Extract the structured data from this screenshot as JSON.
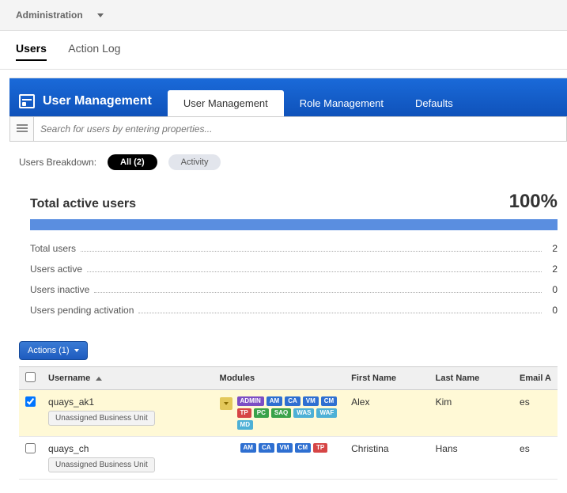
{
  "topbar": {
    "admin_label": "Administration"
  },
  "subtabs": {
    "users": "Users",
    "action_log": "Action Log"
  },
  "hero": {
    "title": "User Management",
    "tabs": {
      "user_mgmt": "User Management",
      "role_mgmt": "Role Management",
      "defaults": "Defaults"
    }
  },
  "search": {
    "placeholder": "Search for users by entering properties..."
  },
  "breakdown": {
    "label": "Users Breakdown:",
    "all_label": "All",
    "all_count": "(2)",
    "activity_label": "Activity"
  },
  "stats": {
    "title": "Total active users",
    "pct": "100%",
    "rows": [
      {
        "label": "Total users",
        "value": "2"
      },
      {
        "label": "Users active",
        "value": "2"
      },
      {
        "label": "Users inactive",
        "value": "0"
      },
      {
        "label": "Users pending activation",
        "value": "0"
      }
    ]
  },
  "actions_button": "Actions (1)",
  "table": {
    "headers": {
      "username": "Username",
      "modules": "Modules",
      "first": "First Name",
      "last": "Last Name",
      "email": "Email A"
    },
    "rows": [
      {
        "checked": true,
        "username": "quays_ak1",
        "bu": "Unassigned Business Unit",
        "modules": [
          "ADMIN",
          "AM",
          "CA",
          "VM",
          "CM",
          "TP",
          "PC",
          "SAQ",
          "WAS",
          "WAF",
          "MD"
        ],
        "first": "Alex",
        "last": "Kim",
        "email": "es"
      },
      {
        "checked": false,
        "username": "quays_ch",
        "bu": "Unassigned Business Unit",
        "modules": [
          "AM",
          "CA",
          "VM",
          "CM",
          "TP"
        ],
        "first": "Christina",
        "last": "Hans",
        "email": "es"
      }
    ]
  }
}
